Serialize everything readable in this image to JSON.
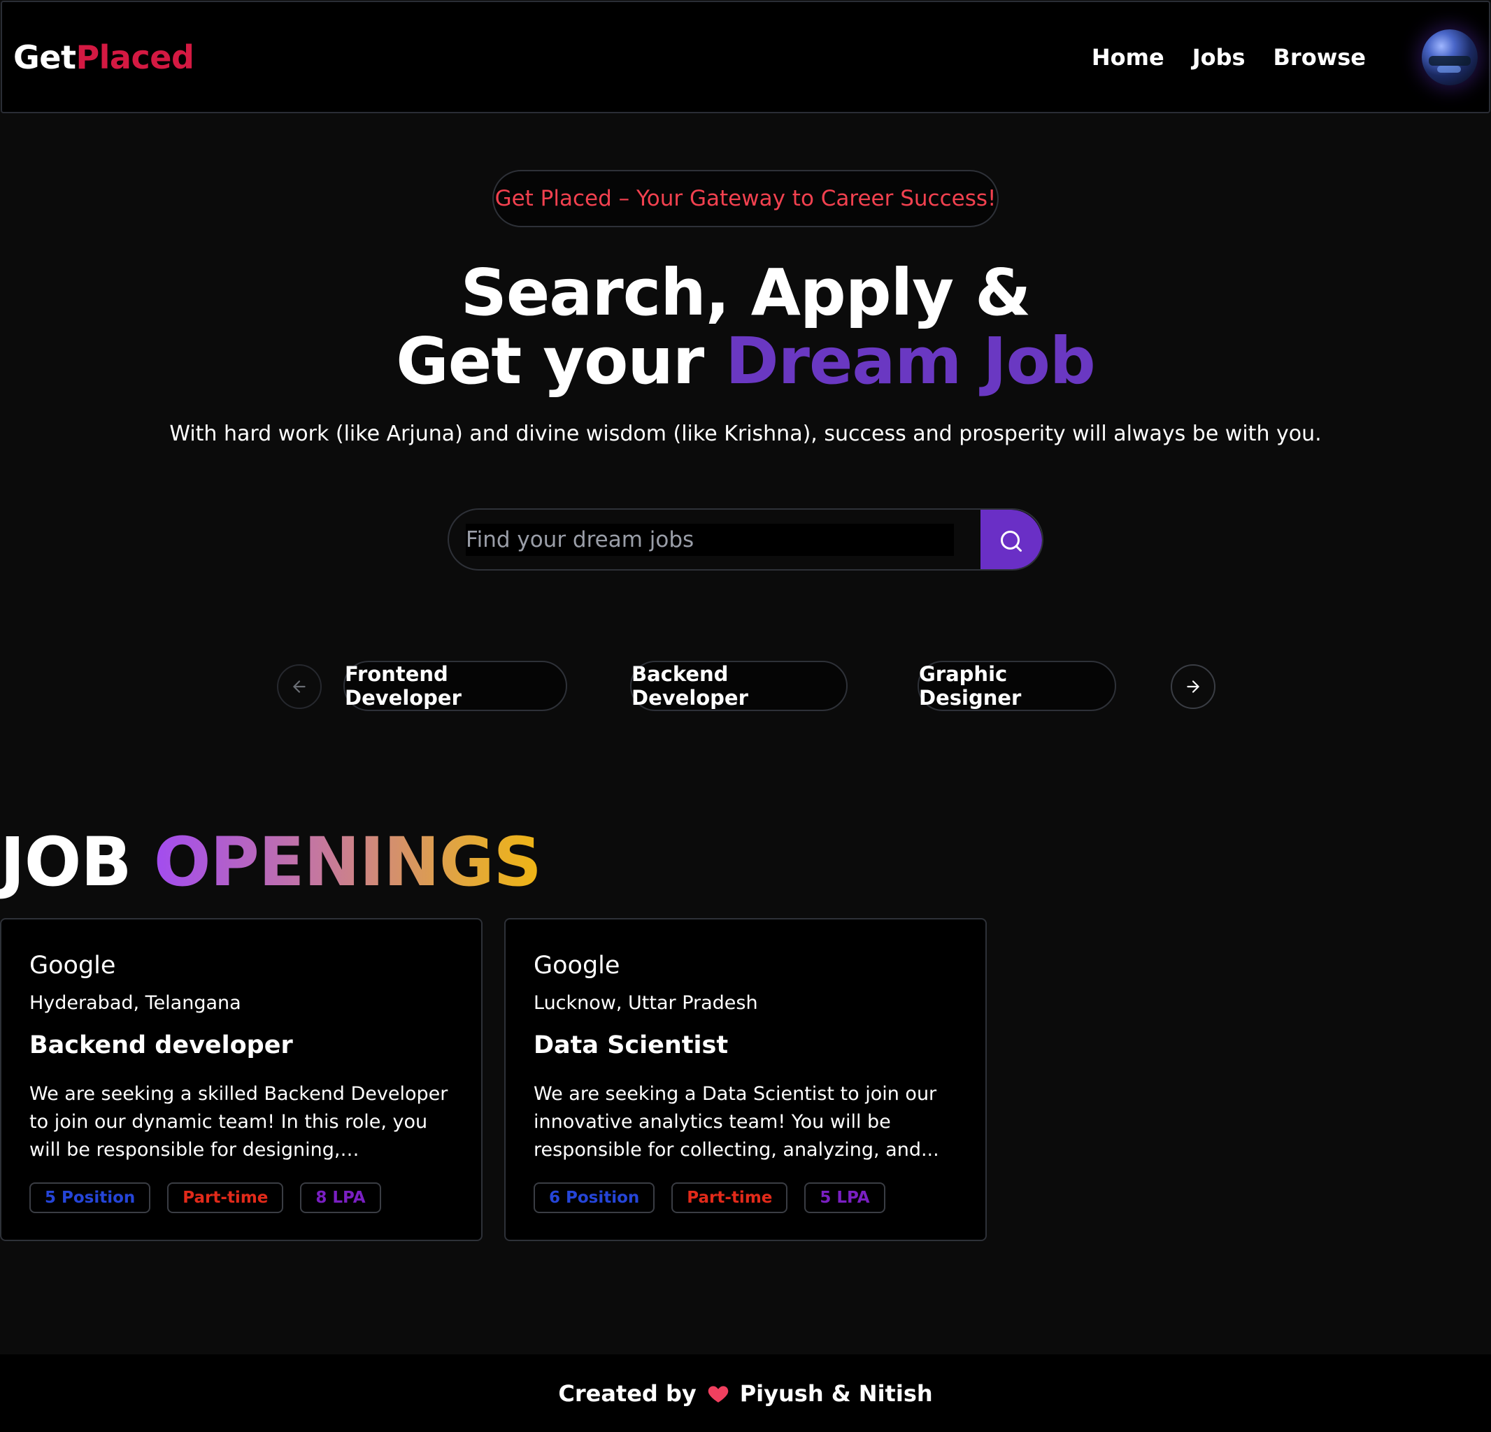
{
  "navbar": {
    "logo_part1": "Get",
    "logo_part2": "Placed",
    "links": [
      "Home",
      "Jobs",
      "Browse"
    ]
  },
  "hero": {
    "badge": "Get Placed – Your Gateway to Career Success!",
    "headline_line1": "Search, Apply &",
    "headline_line2_prefix": "Get your ",
    "headline_line2_highlight": "Dream Job",
    "subtitle": "With hard work (like Arjuna) and divine wisdom (like Krishna), success and prosperity will always be with you."
  },
  "search": {
    "placeholder": "Find your dream jobs",
    "value": ""
  },
  "categories": [
    "Frontend Developer",
    "Backend Developer",
    "Graphic Designer"
  ],
  "job_section": {
    "title_part1": "JOB",
    "title_part2": "OPENINGS"
  },
  "jobs": [
    {
      "company": "Google",
      "location": "Hyderabad, Telangana",
      "title": "Backend developer",
      "description": "We are seeking a skilled Backend Developer to join our dynamic team! In this role, you will be responsible for designing, developing, and...",
      "positions": "5 Position",
      "type": "Part-time",
      "salary": "8 LPA"
    },
    {
      "company": "Google",
      "location": "Lucknow, Uttar Pradesh",
      "title": "Data Scientist",
      "description": "We are seeking a Data Scientist to join our innovative analytics team! You will be responsible for collecting, analyzing, and...",
      "positions": "6 Position",
      "type": "Part-time",
      "salary": "5 LPA"
    }
  ],
  "footer": {
    "created_by": "Created by",
    "authors": "Piyush & Nitish"
  },
  "colors": {
    "brand_red": "#d41942",
    "accent_purple": "#6a38c2",
    "search_button": "#6a2fc6",
    "badge_text_red": "#f2414f"
  },
  "icons": {
    "search": "search-icon",
    "prev": "arrow-left-icon",
    "next": "arrow-right-icon",
    "heart": "heart-icon",
    "avatar": "avatar"
  }
}
